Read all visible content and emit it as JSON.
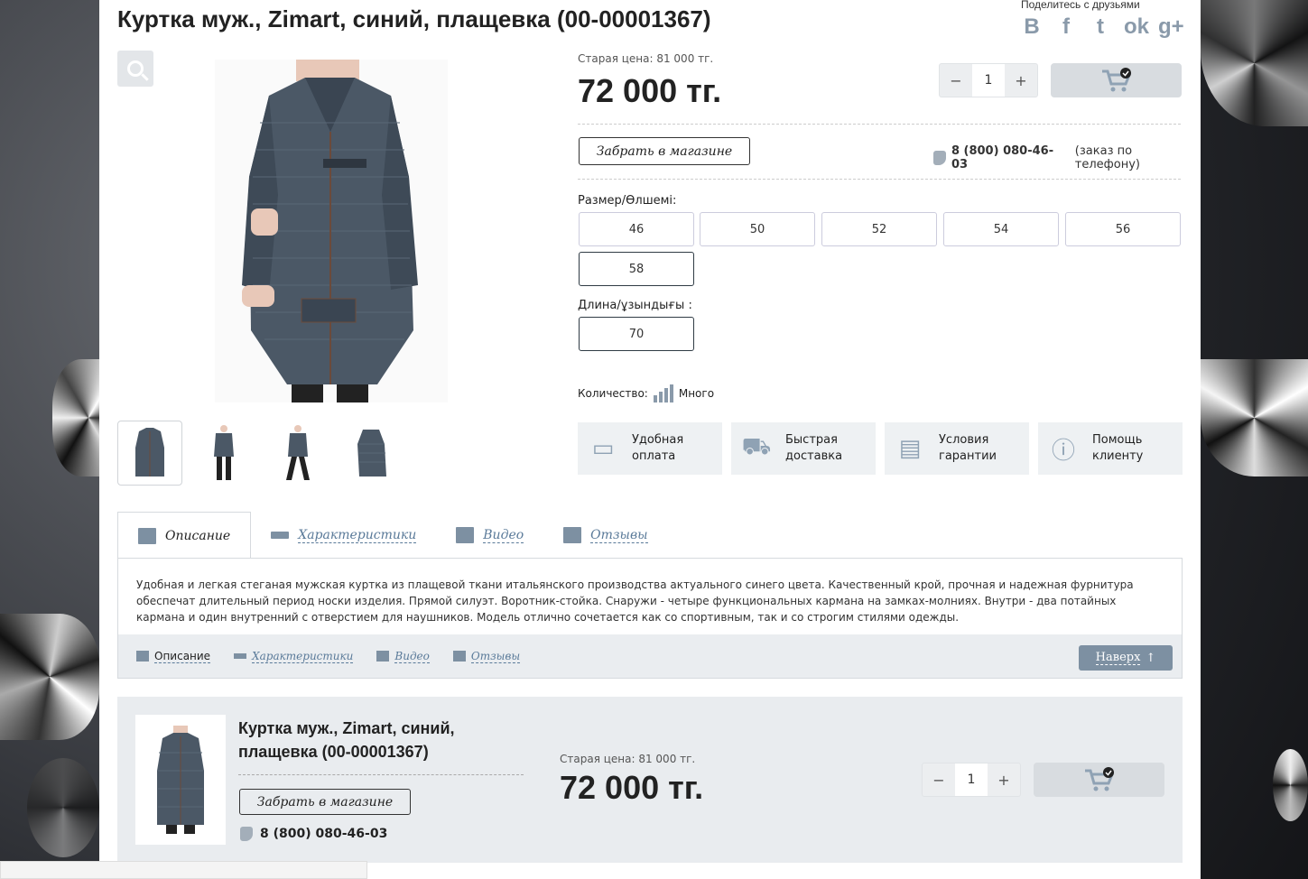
{
  "product": {
    "title": "Куртка муж., Zimart, синий, плащевка (00-00001367)",
    "old_price": "Старая цена: 81 000 тг.",
    "price": "72 000 тг.",
    "quantity": "1",
    "pickup_label": "Забрать в магазине",
    "phone": "8 (800) 080-46-03",
    "phone_note": "(заказ по телефону)"
  },
  "share": {
    "label": "Поделитесь с друзьями",
    "icons": [
      "vk-icon",
      "facebook-icon",
      "twitter-icon",
      "odnoklassniki-icon",
      "google-plus-icon"
    ],
    "glyphs": [
      "B",
      "f",
      "t",
      "ok",
      "g+"
    ]
  },
  "sizes": {
    "label": "Размер/Өлшемі:",
    "options": [
      "46",
      "50",
      "52",
      "54",
      "56",
      "58"
    ],
    "selected": "58"
  },
  "length": {
    "label": "Длина/ұзындығы :",
    "options": [
      "70"
    ],
    "selected": "70"
  },
  "stock": {
    "label": "Количество:",
    "value": "Много"
  },
  "features": [
    {
      "line1": "Удобная",
      "line2": "оплата",
      "icon": "card-icon"
    },
    {
      "line1": "Быстрая",
      "line2": "доставка",
      "icon": "truck-icon"
    },
    {
      "line1": "Условия",
      "line2": "гарантии",
      "icon": "document-icon"
    },
    {
      "line1": "Помощь",
      "line2": "клиенту",
      "icon": "info-icon"
    }
  ],
  "tabs": [
    "Описание",
    "Характеристики",
    "Видео",
    "Отзывы"
  ],
  "description": "Удобная и легкая стеганая мужская куртка из плащевой ткани итальянского производства актуального синего цвета. Качественный крой, прочная и надежная фурнитура обеспечат длительный период носки изделия. Прямой силуэт. Воротник-стойка. Снаружи - четыре функциональных кармана на замках-молниях. Внутри - два потайных кармана и один внутренний с отверстием для наушников. Модель отлично сочетается как со спортивным, так и со строгим стилями одежды.",
  "footer_nav": [
    "Описание",
    "Характеристики",
    "Видео",
    "Отзывы"
  ],
  "up_button": "Наверх",
  "bottom": {
    "title_line1": "Куртка муж., Zimart, синий,",
    "title_line2": "плащевка (00-00001367)",
    "pickup_label": "Забрать в магазине",
    "phone": "8 (800) 080-46-03",
    "old_price": "Старая цена: 81 000 тг.",
    "price": "72 000 тг.",
    "quantity": "1"
  },
  "colors": {
    "accent": "#7d90a2",
    "jacket": "#4b5866"
  }
}
